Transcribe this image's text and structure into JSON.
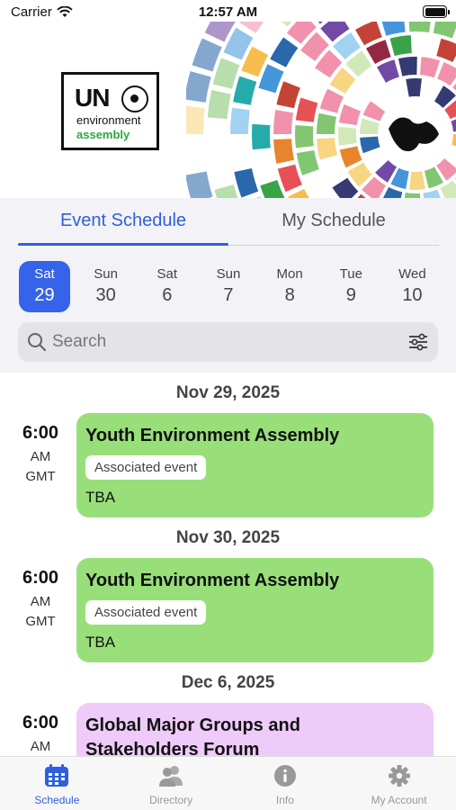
{
  "status": {
    "carrier": "Carrier",
    "time": "12:57 AM"
  },
  "logo": {
    "un": "UN",
    "line1": "environment",
    "line2": "assembly"
  },
  "tabs": {
    "event": "Event Schedule",
    "my": "My Schedule"
  },
  "days": [
    {
      "dow": "Sat",
      "num": "29",
      "active": true
    },
    {
      "dow": "Sun",
      "num": "30"
    },
    {
      "dow": "Sat",
      "num": "6"
    },
    {
      "dow": "Sun",
      "num": "7"
    },
    {
      "dow": "Mon",
      "num": "8"
    },
    {
      "dow": "Tue",
      "num": "9"
    },
    {
      "dow": "Wed",
      "num": "10"
    }
  ],
  "search": {
    "placeholder": "Search"
  },
  "events": [
    {
      "date": "Nov 29, 2025",
      "time": "6:00",
      "ampm": "AM",
      "tz": "GMT",
      "title": "Youth Environment Assembly",
      "tag": "Associated event",
      "location": "TBA",
      "color": "#98df7a"
    },
    {
      "date": "Nov 30, 2025",
      "time": "6:00",
      "ampm": "AM",
      "tz": "GMT",
      "title": "Youth Environment Assembly",
      "tag": "Associated event",
      "location": "TBA",
      "color": "#98df7a"
    },
    {
      "date": "Dec 6, 2025",
      "time": "6:00",
      "ampm": "AM",
      "title": "Global Major Groups and Stakeholders Forum",
      "color": "#efcbfa"
    }
  ],
  "tabbar": {
    "schedule": "Schedule",
    "directory": "Directory",
    "info": "Info",
    "account": "My Account"
  }
}
